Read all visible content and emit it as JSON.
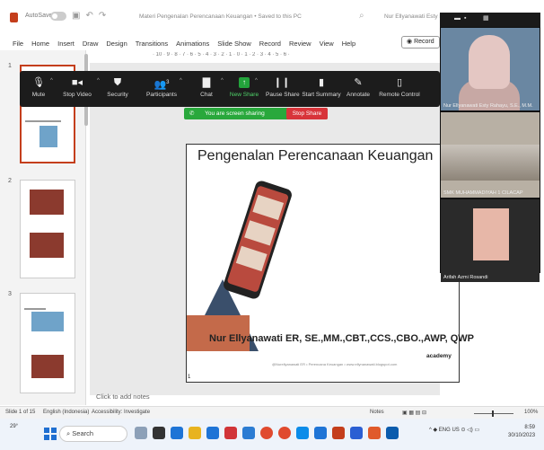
{
  "titlebar": {
    "autosave_label": "AutoSave",
    "toggle_state": "Off",
    "doc_title": "Materi Pengenalan Perencanaan Keuangan • Saved to this PC",
    "user_name": "Nur Ellyanawati Esty Rahayu"
  },
  "ribbon": {
    "tabs": [
      "File",
      "Home",
      "Insert",
      "Draw",
      "Design",
      "Transitions",
      "Animations",
      "Slide Show",
      "Record",
      "Review",
      "View",
      "Help"
    ],
    "record_button": "Record"
  },
  "ruler": "· 10 · 9 · 8 · 7 · 6 · 5 · 4 · 3 · 2 · 1 · 0 · 1 · 2 · 3 · 4 · 5 · 6 ·",
  "zoom_toolbar": {
    "mute": "Mute",
    "stop_video": "Stop Video",
    "security": "Security",
    "participants": "Participants",
    "participants_count": "3",
    "chat": "Chat",
    "new_share": "New Share",
    "pause_share": "Pause Share",
    "start_summary": "Start Summary",
    "annotate": "Annotate",
    "remote_control": "Remote Control"
  },
  "sharing_bar": {
    "message": "You are screen sharing",
    "stop_label": "Stop Share"
  },
  "thumbnails": {
    "slide_numbers": [
      "1",
      "2",
      "3"
    ]
  },
  "slide": {
    "title": "Pengenalan Perencanaan Keuangan",
    "presenter": "Nur Ellyanawati ER, SE.,MM.,CBT.,CCS.,CBO.,AWP, QWP",
    "footer": "@Nurellyanawati ER • Perencana Keuangan • www.ellynanawati.blogspot.com",
    "brand": "academy",
    "page_number": "1"
  },
  "notes_placeholder": "Click to add notes",
  "video_panel": {
    "participants": [
      {
        "name": "Nur Ellyanawati Esty Rahayu, S.E., M.M."
      },
      {
        "name": "SMK MUHAMMADIYAH 1 CILACAP"
      },
      {
        "name": "Arifah Azmi Rosandi"
      }
    ]
  },
  "statusbar": {
    "slide_info": "Slide 1 of 15",
    "language": "English (Indonesia)",
    "accessibility": "Accessibility: Investigate",
    "notes": "Notes",
    "zoom": "100%"
  },
  "taskbar": {
    "weather_temp": "29°",
    "search_label": "Search",
    "lang": "ENG",
    "lang_region": "US",
    "time": "8:59",
    "date": "30/10/2023"
  },
  "colors": {
    "powerpoint_accent": "#c43e1c",
    "zoom_share_green": "#23a33b",
    "stop_share_red": "#d8343a"
  }
}
